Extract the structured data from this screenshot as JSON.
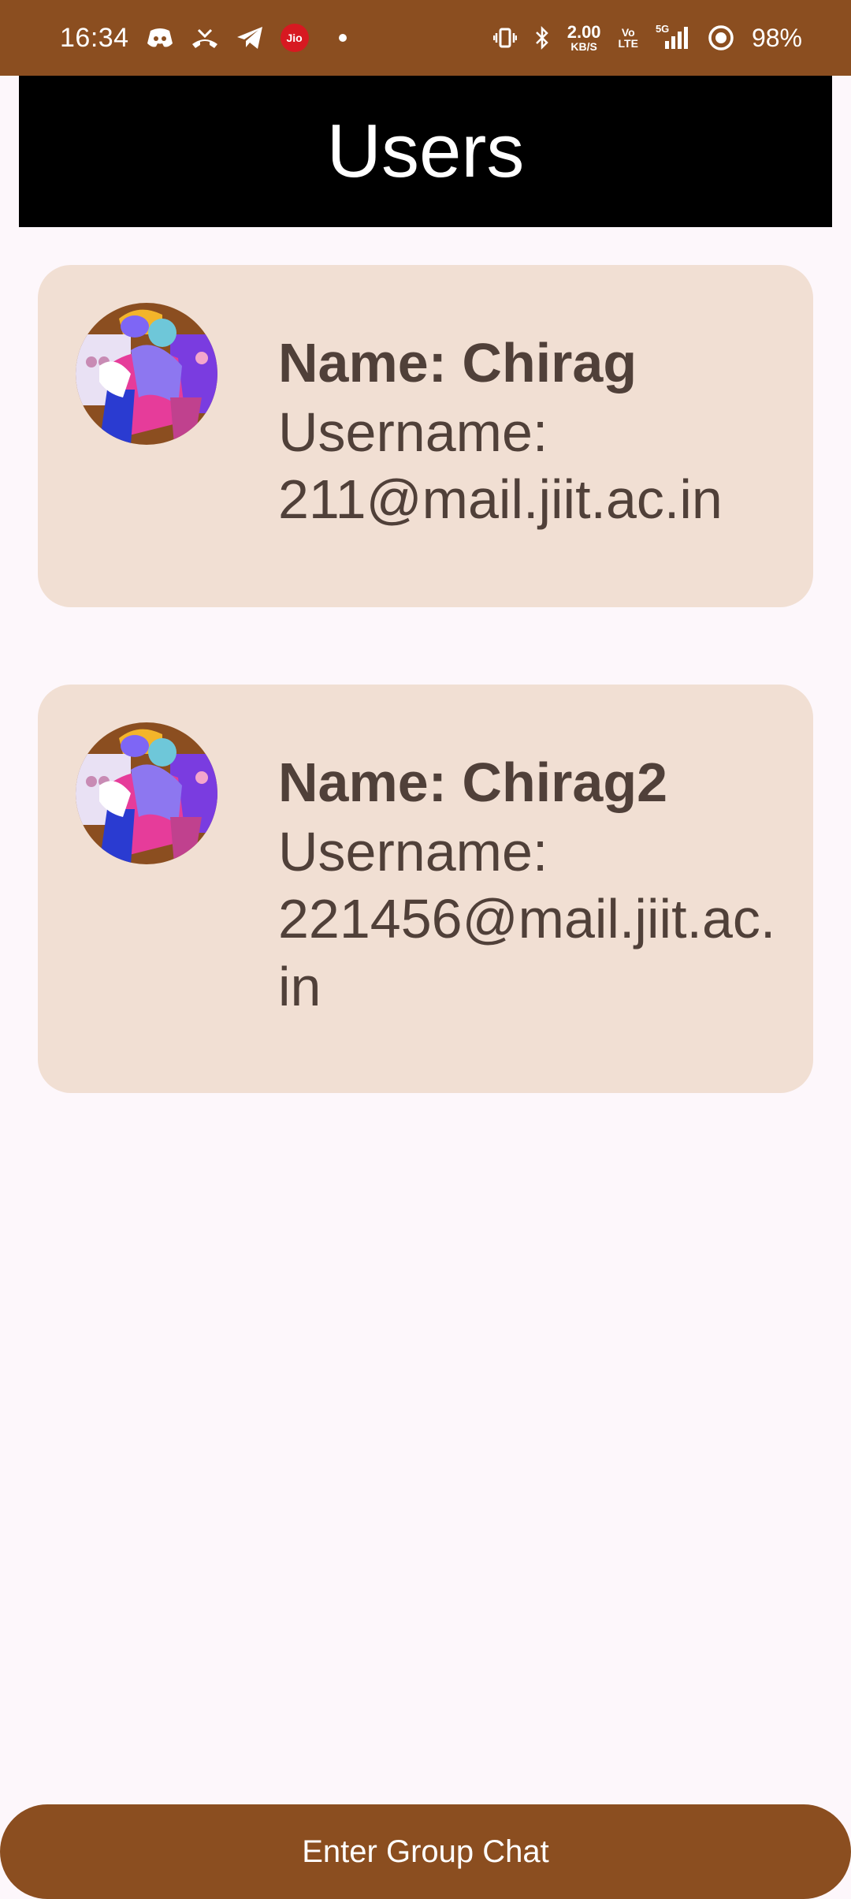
{
  "status_bar": {
    "time": "16:34",
    "left_icons": [
      "discord-icon",
      "missed-call-icon",
      "telegram-icon",
      "jio-icon",
      "notification-dot-icon"
    ],
    "jio_label": "Jio",
    "speed_value": "2.00",
    "speed_unit": "KB/S",
    "volte_label": "Vo\nLTE",
    "network_label": "5G",
    "battery": "98%",
    "right_icons": [
      "vibrate-icon",
      "bluetooth-icon",
      "network-speed",
      "volte-icon",
      "signal-icon",
      "battery-saver-icon"
    ]
  },
  "header": {
    "title": "Users"
  },
  "users": [
    {
      "name_text": "Name: Chirag",
      "username_text": "Username: 211@mail.jiit.ac.in",
      "username_label": "Username:",
      "username_value": "211@mail.jiit.ac.in"
    },
    {
      "name_text": "Name: Chirag2",
      "username_text": "Username: 221456@mail.jiit.ac.in",
      "username_label": "Username:",
      "username_value": "221456@mail.jiit.ac.in"
    }
  ],
  "footer": {
    "button_label": "Enter Group Chat"
  },
  "colors": {
    "status_bar": "#8b4e20",
    "header_bg": "#000000",
    "card_bg": "#f1dfd3",
    "text": "#504039",
    "page_bg": "#fdf7fb",
    "button_bg": "#8b4e20"
  }
}
